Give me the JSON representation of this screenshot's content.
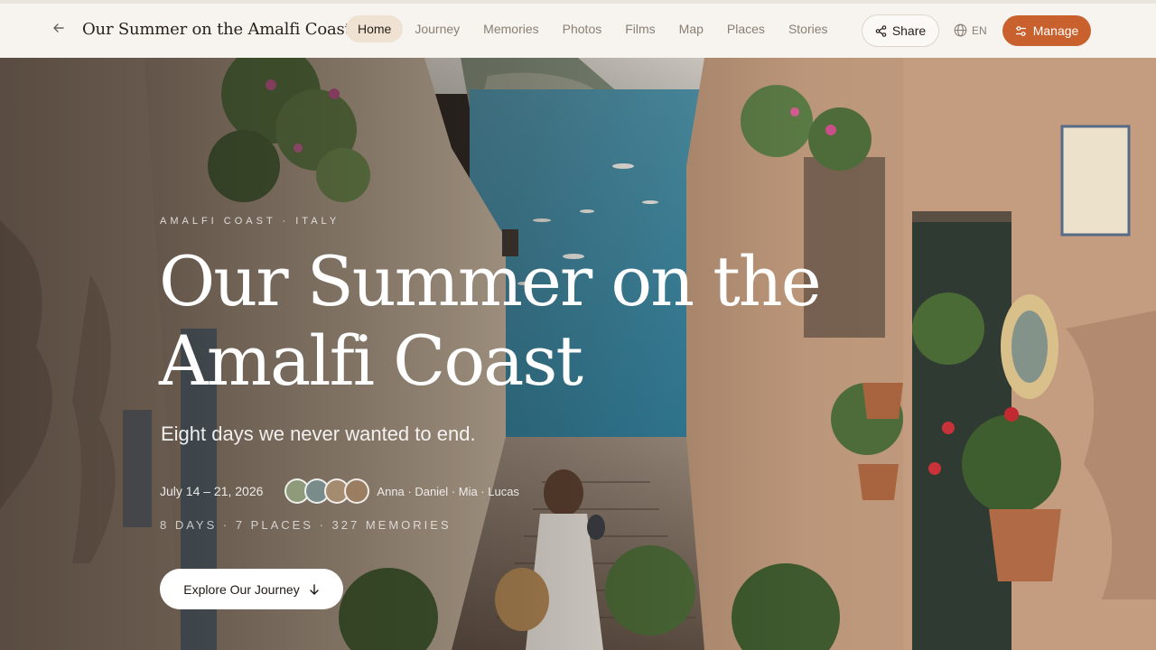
{
  "header": {
    "site_title": "Our Summer on the Amalfi Coast",
    "nav": [
      "Home",
      "Journey",
      "Memories",
      "Photos",
      "Films",
      "Map",
      "Places",
      "Stories"
    ],
    "active_nav": "Home",
    "share_label": "Share",
    "language": "EN",
    "manage_label": "Manage"
  },
  "hero": {
    "eyebrow": "AMALFI COAST · ITALY",
    "title_line1": "Our Summer on the",
    "title_line2": "Amalfi Coast",
    "subtitle": "Eight days we never wanted to end.",
    "dates": "July 14 – 21, 2026",
    "travelers": "Anna · Daniel · Mia · Lucas",
    "stats": "8 DAYS · 7 PLACES · 327 MEMORIES",
    "cta_label": "Explore Our Journey"
  },
  "colors": {
    "accent": "#c8612d",
    "header_bg": "#f7f3ee",
    "active_nav_bg": "#efe2d2"
  },
  "icons": {
    "back": "arrow-left-icon",
    "share": "share-icon",
    "language": "globe-icon",
    "manage": "sliders-icon",
    "cta": "arrow-down-icon"
  }
}
